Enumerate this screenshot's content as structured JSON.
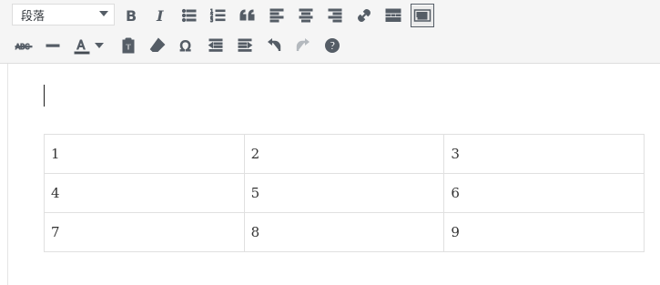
{
  "toolbar": {
    "format_select": {
      "value": "段落"
    },
    "row1": [
      {
        "name": "bold-icon"
      },
      {
        "name": "italic-icon"
      },
      {
        "name": "bulleted-list-icon"
      },
      {
        "name": "numbered-list-icon"
      },
      {
        "name": "blockquote-icon"
      },
      {
        "name": "align-left-icon"
      },
      {
        "name": "align-center-icon"
      },
      {
        "name": "align-right-icon"
      },
      {
        "name": "link-icon"
      },
      {
        "name": "read-more-icon"
      },
      {
        "name": "toolbar-toggle-icon",
        "active": true
      }
    ],
    "row2": [
      {
        "name": "strikethrough-icon"
      },
      {
        "name": "horizontal-line-icon"
      },
      {
        "name": "text-color-icon"
      },
      {
        "name": "text-color-dropdown-icon"
      },
      {
        "name": "paste-as-text-icon"
      },
      {
        "name": "clear-formatting-icon"
      },
      {
        "name": "special-character-icon"
      },
      {
        "name": "outdent-icon"
      },
      {
        "name": "indent-icon"
      },
      {
        "name": "undo-icon"
      },
      {
        "name": "redo-icon",
        "disabled": true
      },
      {
        "name": "help-icon"
      }
    ]
  },
  "editor": {
    "table": [
      [
        "1",
        "2",
        "3"
      ],
      [
        "4",
        "5",
        "6"
      ],
      [
        "7",
        "8",
        "9"
      ]
    ]
  }
}
